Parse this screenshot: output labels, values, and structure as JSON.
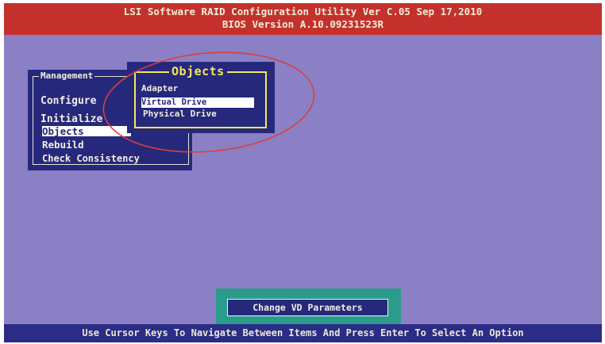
{
  "header": {
    "title_line1": "LSI Software RAID Configuration Utility Ver C.05 Sep 17,2010",
    "title_line2": "BIOS Version  A.10.09231523R"
  },
  "management_menu": {
    "title": "Management",
    "items": [
      {
        "label": "Configure",
        "selected": false
      },
      {
        "label": "Initialize",
        "selected": false
      },
      {
        "label": "Objects",
        "selected": true
      },
      {
        "label": "Rebuild",
        "selected": false
      },
      {
        "label": "Check Consistency",
        "selected": false
      }
    ]
  },
  "objects_menu": {
    "title": "Objects",
    "items": [
      {
        "label": "Adapter",
        "selected": false
      },
      {
        "label": "Virtual Drive",
        "selected": true
      },
      {
        "label": "Physical Drive",
        "selected": false
      }
    ]
  },
  "dialog": {
    "label": "Change VD Parameters"
  },
  "status_bar": {
    "text": "Use Cursor Keys To Navigate Between Items And Press Enter To Select An Option"
  },
  "colors": {
    "screen_background": "#8b80c6",
    "title_bar": "#c4312c",
    "menu_panel": "#26287c",
    "objects_frame": "#f4e75a",
    "dialog_background": "#2b9c8c",
    "highlight_ellipse": "#d8403c"
  }
}
